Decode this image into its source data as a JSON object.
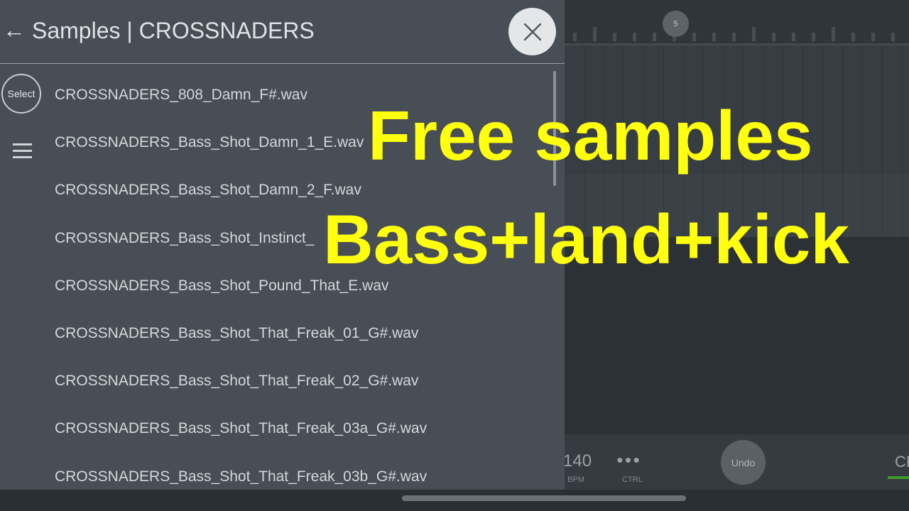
{
  "panel": {
    "back_arrow": "←",
    "title": "Samples | CROSSNADERS",
    "select_label": "Select",
    "files": [
      "CROSSNADERS_808_Damn_F#.wav",
      "CROSSNADERS_Bass_Shot_Damn_1_E.wav",
      "CROSSNADERS_Bass_Shot_Damn_2_F.wav",
      "CROSSNADERS_Bass_Shot_Instinct_",
      "CROSSNADERS_Bass_Shot_Pound_That_E.wav",
      "CROSSNADERS_Bass_Shot_That_Freak_01_G#.wav",
      "CROSSNADERS_Bass_Shot_That_Freak_02_G#.wav",
      "CROSSNADERS_Bass_Shot_That_Freak_03a_G#.wav",
      "CROSSNADERS_Bass_Shot_That_Freak_03b_G#.wav"
    ]
  },
  "daw": {
    "marker_label": "5",
    "bpm_value": "140",
    "bpm_label": "BPM",
    "ctrl_dots": "●●●",
    "ctrl_label": "CTRL",
    "undo_label": "Undo",
    "cr_label": "CR"
  },
  "caption": {
    "line1": "Free samples",
    "line2": "Bass+land+kick",
    "color": "#ffff0e"
  },
  "colors": {
    "panel_bg": "#474e55",
    "daw_bg": "#30363b",
    "accent_green": "#3f9a2a"
  }
}
